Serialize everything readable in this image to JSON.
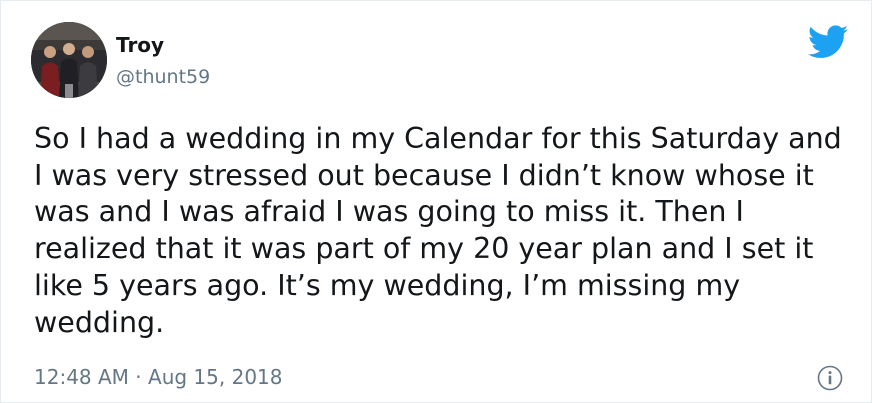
{
  "tweet": {
    "author": {
      "name": "Troy",
      "handle": "@thunt59",
      "avatar_icon": "profile-photo-icon"
    },
    "text": "So I had a wedding in my Calendar for this Saturday and I was very stressed out because I didn’t know whose it was and I was afraid I was going to miss it. Then I realized that it was part of my 20 year plan and I set it like 5 years ago. It’s my wedding, I’m missing my wedding.",
    "time": "12:48 AM",
    "separator": "·",
    "date": "Aug 15, 2018",
    "brand_icon": "twitter-bird-icon",
    "info_icon": "info-icon"
  },
  "colors": {
    "brand": "#1da1f2",
    "text": "#14171a",
    "muted": "#657786",
    "border": "#e6ecf0"
  }
}
